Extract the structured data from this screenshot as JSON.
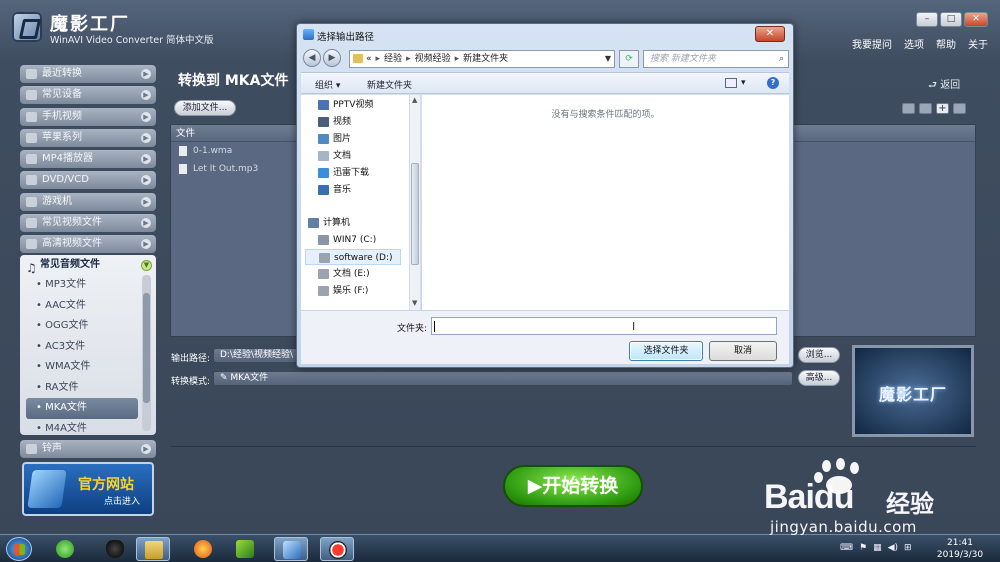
{
  "app": {
    "title": "魔影工厂",
    "subtitle": "WinAVI Video Converter 简体中文版",
    "menu": [
      "我要提问",
      "选项",
      "帮助",
      "关于"
    ],
    "window_buttons": [
      "–",
      "□",
      "✕"
    ]
  },
  "sidebar": {
    "categories": [
      "最近转换",
      "常见设备",
      "手机视频",
      "苹果系列",
      "MP4播放器",
      "DVD/VCD",
      "游戏机",
      "常见视频文件",
      "高清视频文件"
    ],
    "audio_group": {
      "title": "常见音频文件",
      "formats": [
        "MP3文件",
        "AAC文件",
        "OGG文件",
        "AC3文件",
        "WMA文件",
        "RA文件",
        "MKA文件",
        "M4A文件"
      ],
      "selected": "MKA文件"
    },
    "ringtone": "铃声",
    "banner_title": "官方网站",
    "banner_sub": "点击进入"
  },
  "main": {
    "title": "转换到 MKA文件",
    "back": "返回",
    "add_file": "添加文件...",
    "list_header": "文件",
    "files": [
      "0-1.wma",
      "Let It Out.mp3"
    ],
    "output_path_label": "输出路径:",
    "output_path_value": "D:\\经验\\视频经验\\",
    "browse": "浏览...",
    "mode_label": "转换模式:",
    "mode_value": "MKA文件",
    "advanced": "高级...",
    "preview_text": "魔影工厂",
    "start": "▶开始转换"
  },
  "dialog": {
    "title": "选择输出路径",
    "close": "✕",
    "breadcrumb": [
      "«",
      "经验",
      "视频经验",
      "新建文件夹"
    ],
    "search_placeholder": "搜索 新建文件夹",
    "organize": "组织 ▾",
    "new_folder": "新建文件夹",
    "tree": [
      {
        "label": "PPTV视频",
        "color": "#4b73b3"
      },
      {
        "label": "视频",
        "color": "#4a5d7a"
      },
      {
        "label": "图片",
        "color": "#4f8ac4"
      },
      {
        "label": "文档",
        "color": "#a6b4c8"
      },
      {
        "label": "迅雷下载",
        "color": "#3c8dde"
      },
      {
        "label": "音乐",
        "color": "#3a6fb0"
      },
      {
        "label": "计算机",
        "color": "#5e7fa6"
      },
      {
        "label": "WIN7 (C:)",
        "color": "#8a96a6"
      },
      {
        "label": "software (D:)",
        "color": "#9aa3ae"
      },
      {
        "label": "文档 (E:)",
        "color": "#9aa3ae"
      },
      {
        "label": "娱乐 (F:)",
        "color": "#9aa3ae"
      }
    ],
    "empty_message": "没有与搜索条件匹配的项。",
    "filename_label": "文件夹:",
    "filename_value": "",
    "select_button": "选择文件夹",
    "cancel_button": "取消"
  },
  "taskbar": {
    "time": "21:41",
    "date": "2019/3/30"
  },
  "watermark": {
    "brand": "Bai du 经验",
    "url": "jingyan.baidu.com"
  }
}
